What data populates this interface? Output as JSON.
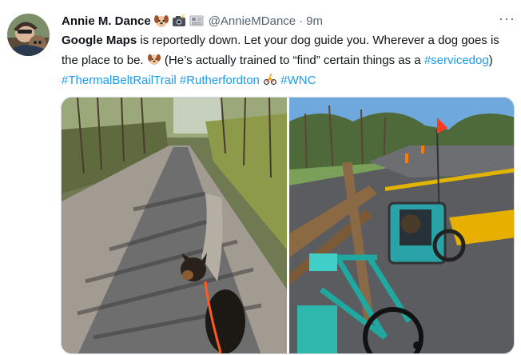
{
  "author": {
    "name": "Annie M. Dance",
    "handle": "@AnnieMDance",
    "separator": "·",
    "time": "9m",
    "badges": [
      "dog-face-icon",
      "camera-flash-icon",
      "newspaper-icon"
    ]
  },
  "more_label": "···",
  "tweet": {
    "bold_lead": "Google Maps",
    "text1": " is reportedly down. Let your dog guide you. Wherever a dog goes is the place to be. ",
    "text2": " (He’s actually trained to “find” certain things as a ",
    "hashtags": [
      "#servicedog",
      "#ThermalBeltRailTrail",
      "#Rutherfordton",
      "#WNC"
    ],
    "close_paren": ")"
  },
  "colors": {
    "link": "#1d9bf0",
    "secondary": "#536471",
    "border": "#cfd9de"
  },
  "media": {
    "photos": [
      {
        "subject": "dog on paved rail trail with orange leash",
        "icon": "photo-trail-dog"
      },
      {
        "subject": "teal bicycle with dog trailer at trail crossing",
        "icon": "photo-bike-trailer"
      }
    ]
  }
}
